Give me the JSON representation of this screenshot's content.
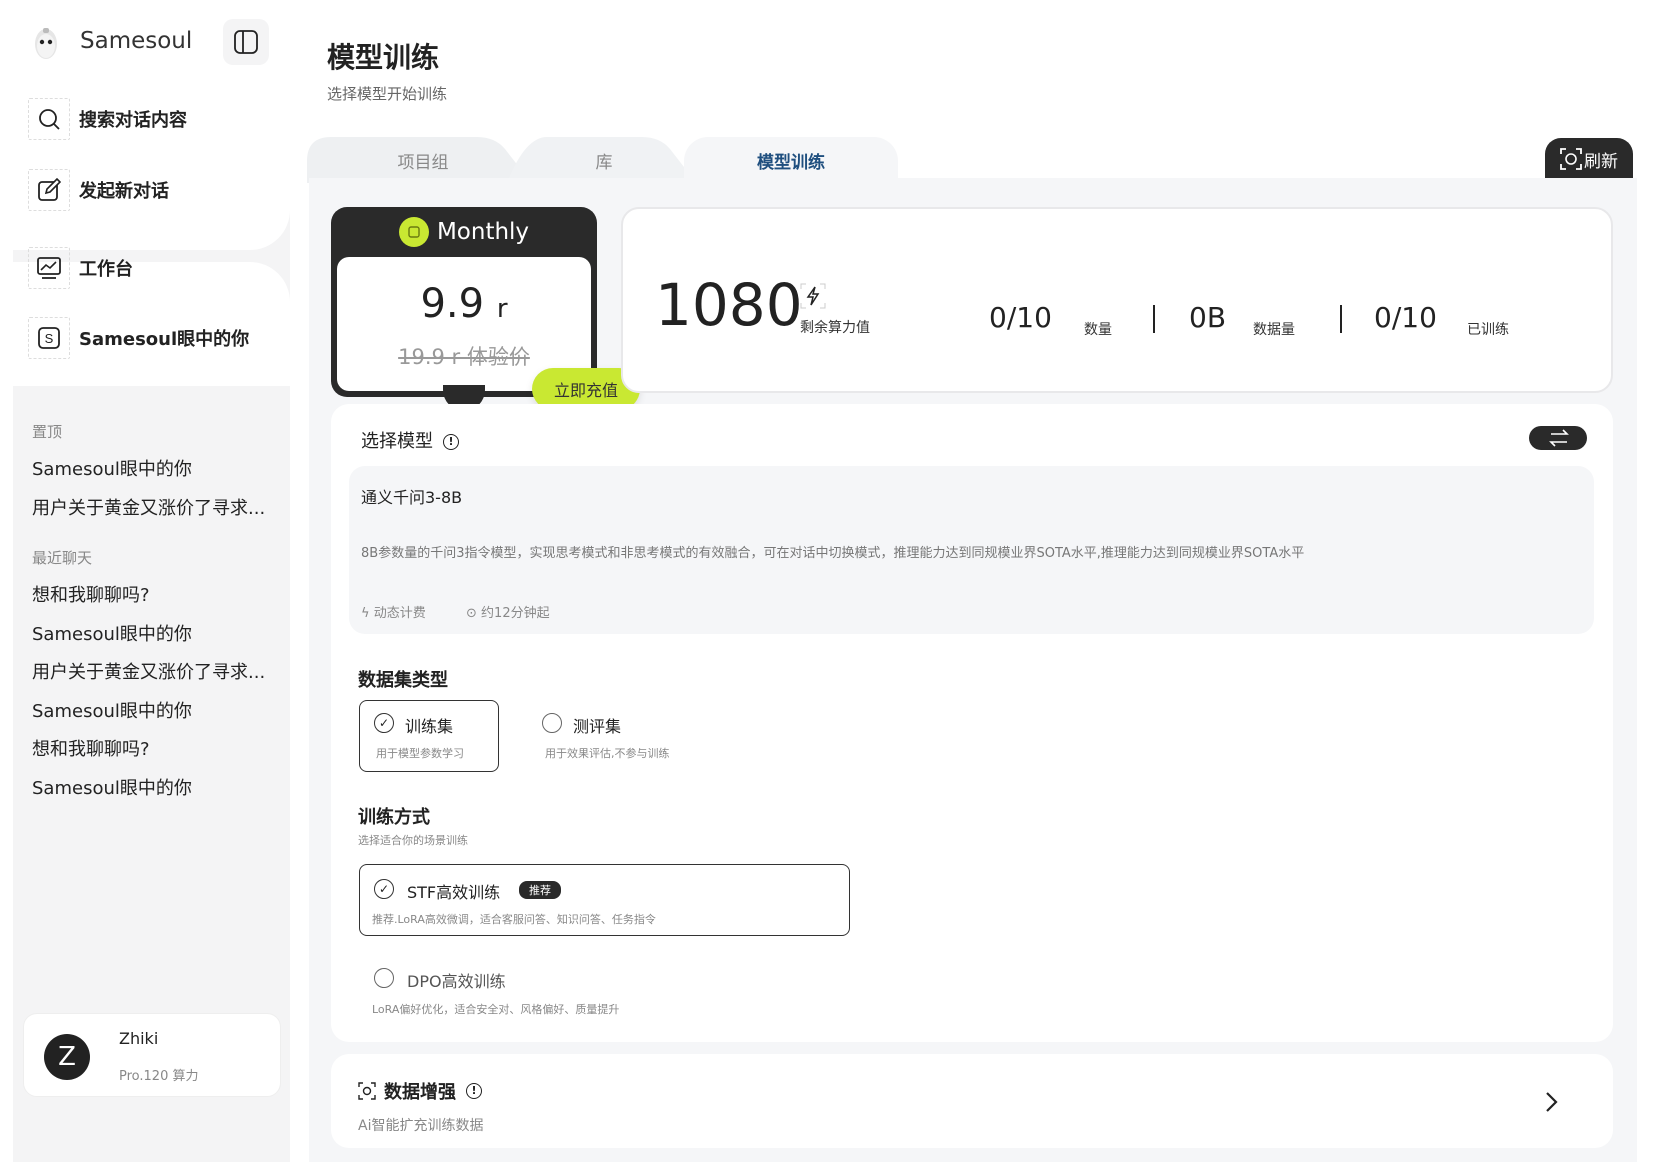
{
  "sidebar": {
    "brand_name": "Samesoul",
    "nav": [
      {
        "label": "搜索对话内容",
        "icon": "search-icon"
      },
      {
        "label": "发起新对话",
        "icon": "edit-icon"
      },
      {
        "label": "工作台",
        "icon": "chart-icon"
      },
      {
        "label": "Samesoul眼中的你",
        "icon": "s-box-icon"
      }
    ],
    "pinned_title": "置顶",
    "pinned": [
      "Samesoul眼中的你",
      "用户关于黄金又涨价了寻求..."
    ],
    "recent_title": "最近聊天",
    "recent": [
      "想和我聊聊吗?",
      "Samesoul眼中的你",
      "用户关于黄金又涨价了寻求...",
      "Samesoul眼中的你",
      "想和我聊聊吗?",
      "Samesoul眼中的你"
    ],
    "user": {
      "initial": "Z",
      "name": "Zhiki",
      "plan": "Pro.120 算力"
    }
  },
  "header": {
    "title": "模型训练",
    "subtitle": "选择模型开始训练"
  },
  "tabs": [
    {
      "label": "项目组",
      "active": false
    },
    {
      "label": "库",
      "active": false
    },
    {
      "label": "模型训练",
      "active": true
    }
  ],
  "refresh_label": "刷新",
  "plan_card": {
    "name": "Monthly",
    "price": "9.9",
    "price_unit": "r",
    "original_price": "19.9 r 体验价",
    "recharge_label": "立即充值"
  },
  "stats": {
    "compute_value": "1080",
    "compute_label": "剩余算力值",
    "items": [
      {
        "value": "0/10",
        "label": "数量"
      },
      {
        "value": "0B",
        "label": "数据量"
      },
      {
        "value": "0/10",
        "label": "已训练"
      }
    ]
  },
  "model_select": {
    "title": "选择模型",
    "model_name": "通义千问3-8B",
    "description": "8B参数量的千问3指令模型，实现思考模式和非思考模式的有效融合，可在对话中切换模式，推理能力达到同规模业界SOTA水平,推理能力达到同规模业界SOTA水平",
    "billing": "动态计费",
    "duration": "约12分钟起"
  },
  "dataset_type": {
    "title": "数据集类型",
    "options": [
      {
        "label": "训练集",
        "sub": "用于模型参数学习",
        "selected": true
      },
      {
        "label": "测评集",
        "sub": "用于效果评估,不参与训练",
        "selected": false
      }
    ]
  },
  "training_method": {
    "title": "训练方式",
    "subtitle": "选择适合你的场景训练",
    "options": [
      {
        "label": "STF高效训练",
        "badge": "推荐",
        "sub": "推荐.LoRA高效微调，适合客服问答、知识问答、任务指令",
        "selected": true
      },
      {
        "label": "DPO高效训练",
        "sub": "LoRA偏好优化，适合安全对、风格偏好、质量提升",
        "selected": false
      }
    ]
  },
  "augmentation": {
    "title": "数据增强",
    "subtitle": "Ai智能扩充训练数据"
  },
  "colors": {
    "accent": "#c9e832",
    "dark": "#2a2a2a",
    "tab_active": "#1f4f7f"
  }
}
